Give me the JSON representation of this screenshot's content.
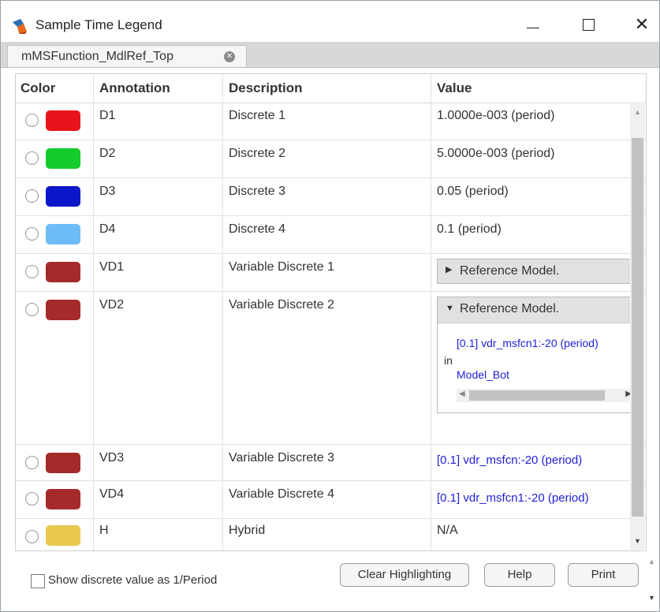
{
  "window": {
    "title": "Sample Time Legend"
  },
  "tab": {
    "label": "mMSFunction_MdlRef_Top"
  },
  "table": {
    "headers": {
      "color": "Color",
      "annotation": "Annotation",
      "description": "Description",
      "value": "Value"
    },
    "rows": [
      {
        "color": "#e8141b",
        "annotation": "D1",
        "description": "Discrete 1",
        "value": "1.0000e-003 (period)"
      },
      {
        "color": "#14cc2a",
        "annotation": "D2",
        "description": "Discrete 2",
        "value": "5.0000e-003 (period)"
      },
      {
        "color": "#0b16c9",
        "annotation": "D3",
        "description": "Discrete 3",
        "value": "0.05 (period)"
      },
      {
        "color": "#6ebcf5",
        "annotation": "D4",
        "description": "Discrete 4",
        "value": "0.1 (period)"
      },
      {
        "color": "#a52a2a",
        "annotation": "VD1",
        "description": "Variable Discrete 1",
        "value": "Reference Model."
      },
      {
        "color": "#a52a2a",
        "annotation": "VD2",
        "description": "Variable Discrete 2",
        "value": "Reference Model.",
        "detail": {
          "link": "[0.1] vdr_msfcn1:-20  (period)",
          "in": "in",
          "model": "Model_Bot"
        }
      },
      {
        "color": "#a52a2a",
        "annotation": "VD3",
        "description": "Variable Discrete 3",
        "value": "[0.1] vdr_msfcn:-20  (period)"
      },
      {
        "color": "#a52a2a",
        "annotation": "VD4",
        "description": "Variable Discrete 4",
        "value": "[0.1] vdr_msfcn1:-20  (period)"
      },
      {
        "color": "#e8c94e",
        "annotation": "H",
        "description": "Hybrid",
        "value": "N/A"
      }
    ]
  },
  "footer": {
    "checkbox_label": "Show discrete value as 1/Period",
    "checkbox_checked": false,
    "clear_label": "Clear Highlighting",
    "help_label": "Help",
    "print_label": "Print"
  }
}
